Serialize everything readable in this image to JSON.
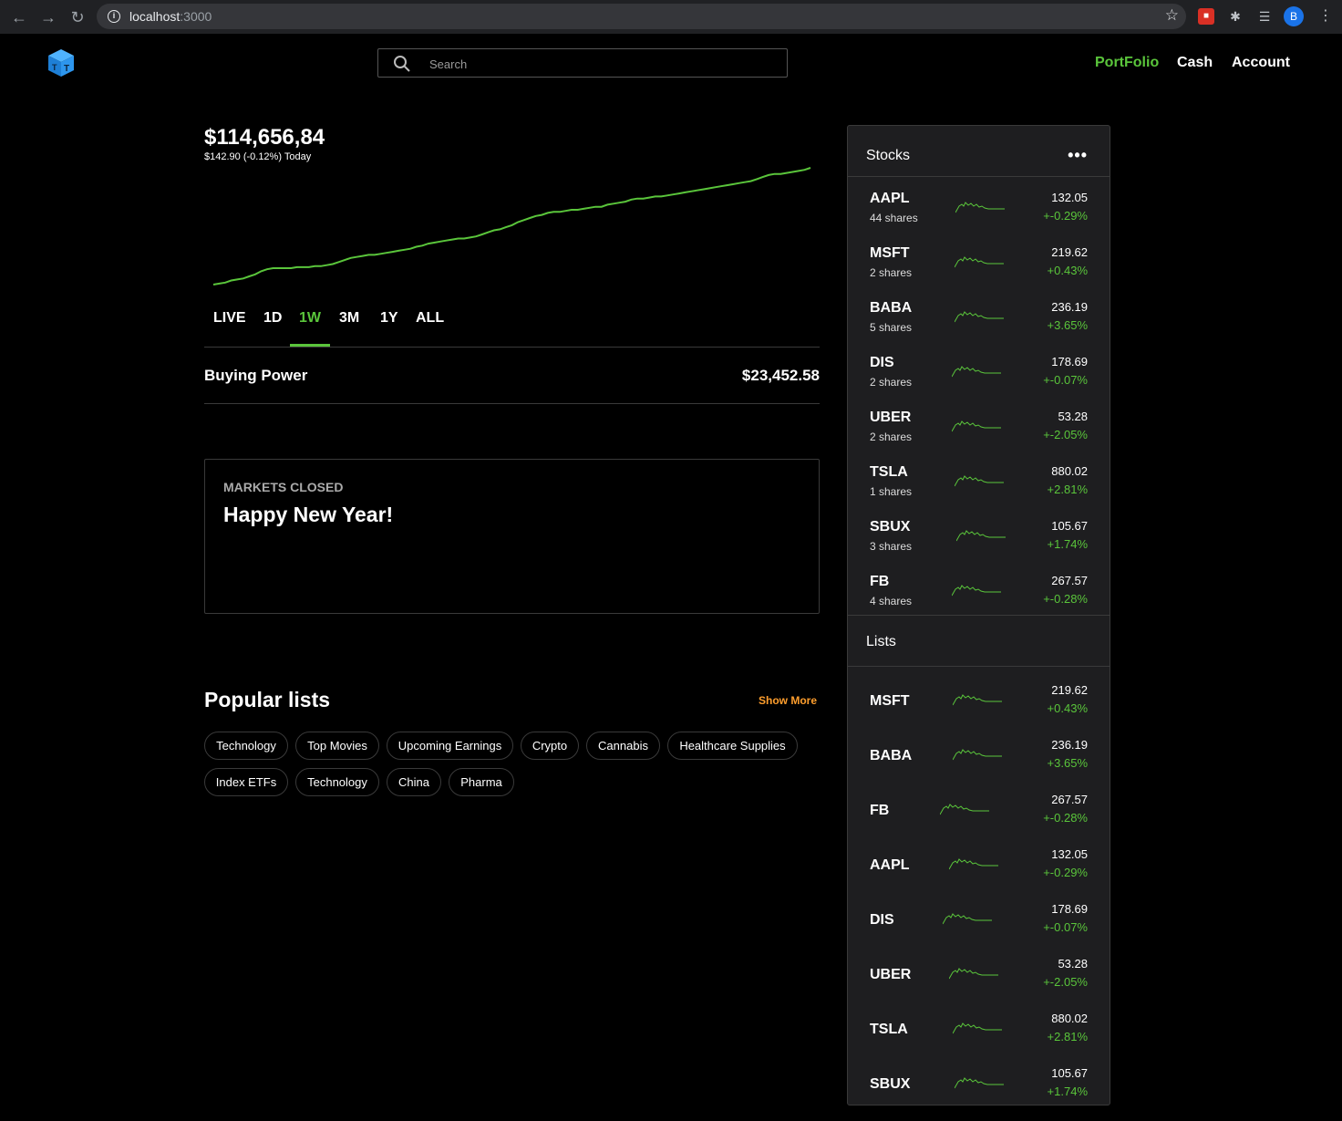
{
  "browser": {
    "url_host": "localhost",
    "url_port": ":3000",
    "profile_initial": "B"
  },
  "header": {
    "search_placeholder": "Search",
    "nav": {
      "portfolio": "PortFolio",
      "cash": "Cash",
      "account": "Account"
    },
    "accent": "#5ac53b"
  },
  "portfolio": {
    "value": "$114,656,84",
    "change": "$142.90 (-0.12%) Today",
    "chart_data": {
      "type": "line",
      "values": [
        0,
        1,
        2,
        4,
        5,
        6,
        8,
        10,
        13,
        15,
        16,
        16,
        16,
        16,
        17,
        17,
        17,
        18,
        18,
        19,
        20,
        22,
        24,
        26,
        27,
        28,
        29,
        29,
        30,
        31,
        32,
        33,
        34,
        35,
        37,
        38,
        40,
        41,
        42,
        43,
        44,
        45,
        45,
        46,
        47,
        49,
        51,
        53,
        54,
        56,
        58,
        61,
        63,
        65,
        67,
        68,
        70,
        71,
        71,
        72,
        73,
        73,
        74,
        75,
        76,
        76,
        78,
        79,
        80,
        81,
        83,
        84,
        84,
        85,
        86,
        86,
        87,
        88,
        89,
        90,
        91,
        92,
        93,
        94,
        95,
        96,
        97,
        98,
        99,
        100,
        101,
        103,
        105,
        107,
        108,
        108,
        109,
        110,
        111,
        112,
        114
      ]
    },
    "ranges": [
      "LIVE",
      "1D",
      "1W",
      "3M",
      "1Y",
      "ALL"
    ],
    "active_range": "1W",
    "buying_power_label": "Buying Power",
    "buying_power": "$23,452.58"
  },
  "market": {
    "status": "MARKETS CLOSED",
    "message": "Happy New Year!"
  },
  "popular": {
    "title": "Popular lists",
    "show_more": "Show More",
    "chips": [
      "Technology",
      "Top Movies",
      "Upcoming Earnings",
      "Crypto",
      "Cannabis",
      "Healthcare Supplies",
      "Index ETFs",
      "Technology",
      "China",
      "Pharma"
    ]
  },
  "stocks_panel": {
    "title": "Stocks",
    "more_icon": "more-horizontal-icon",
    "items": [
      {
        "symbol": "AAPL",
        "shares": "44 shares",
        "price": "132.05",
        "change": "+-0.29%"
      },
      {
        "symbol": "MSFT",
        "shares": "2 shares",
        "price": "219.62",
        "change": "+0.43%"
      },
      {
        "symbol": "BABA",
        "shares": "5 shares",
        "price": "236.19",
        "change": "+3.65%"
      },
      {
        "symbol": "DIS",
        "shares": "2 shares",
        "price": "178.69",
        "change": "+-0.07%"
      },
      {
        "symbol": "UBER",
        "shares": "2 shares",
        "price": "53.28",
        "change": "+-2.05%"
      },
      {
        "symbol": "TSLA",
        "shares": "1 shares",
        "price": "880.02",
        "change": "+2.81%"
      },
      {
        "symbol": "SBUX",
        "shares": "3 shares",
        "price": "105.67",
        "change": "+1.74%"
      },
      {
        "symbol": "FB",
        "shares": "4 shares",
        "price": "267.57",
        "change": "+-0.28%"
      }
    ]
  },
  "lists_panel": {
    "title": "Lists",
    "items": [
      {
        "symbol": "MSFT",
        "price": "219.62",
        "change": "+0.43%"
      },
      {
        "symbol": "BABA",
        "price": "236.19",
        "change": "+3.65%"
      },
      {
        "symbol": "FB",
        "price": "267.57",
        "change": "+-0.28%"
      },
      {
        "symbol": "AAPL",
        "price": "132.05",
        "change": "+-0.29%"
      },
      {
        "symbol": "DIS",
        "price": "178.69",
        "change": "+-0.07%"
      },
      {
        "symbol": "UBER",
        "price": "53.28",
        "change": "+-2.05%"
      },
      {
        "symbol": "TSLA",
        "price": "880.02",
        "change": "+2.81%"
      },
      {
        "symbol": "SBUX",
        "price": "105.67",
        "change": "+1.74%"
      }
    ]
  }
}
